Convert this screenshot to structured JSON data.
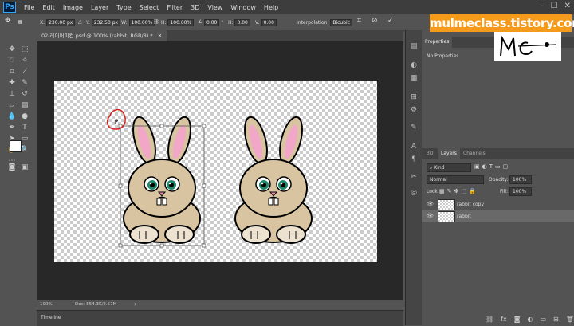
{
  "app": {
    "logo": "Ps"
  },
  "menu": [
    "File",
    "Edit",
    "Image",
    "Layer",
    "Type",
    "Select",
    "Filter",
    "3D",
    "View",
    "Window",
    "Help"
  ],
  "window_controls": [
    "–",
    "☐",
    "✕"
  ],
  "options": {
    "x_label": "X:",
    "x_value": "230.00 px",
    "y_label": "Y:",
    "y_value": "232.50 px",
    "w_label": "W:",
    "w_value": "100.00%",
    "h_label": "H:",
    "h_value": "100.00%",
    "angle_value": "0.00",
    "h2_label": "H:",
    "h2_value": "0.00",
    "v_label": "V:",
    "v_value": "0.00",
    "interp_label": "Interpolation:",
    "interp_value": "Bicubic"
  },
  "document": {
    "tab_title": "02-레이어피컨.psd @ 100% (rabbit, RGB/8) *",
    "tab_close": "✕"
  },
  "status": {
    "zoom": "100%",
    "doc_info": "Doc: 854.3K/2.57M"
  },
  "timeline": {
    "label": "Timeline"
  },
  "properties": {
    "tab": "Properties",
    "text": "No Properties"
  },
  "layers_panel": {
    "tabs": [
      "3D",
      "Layers",
      "Channels"
    ],
    "kind": "Kind",
    "blend_mode": "Normal",
    "opacity_label": "Opacity:",
    "opacity_value": "100%",
    "lock_label": "Lock:",
    "fill_label": "Fill:",
    "fill_value": "100%",
    "layers": [
      {
        "name": "rabbit copy",
        "selected": false
      },
      {
        "name": "rabbit",
        "selected": true
      }
    ]
  },
  "watermark": {
    "text": "mulmeclass.tistory.com",
    "signature": "Mc"
  },
  "colors": {
    "accent": "#f59a1b",
    "panel": "#535353",
    "dark": "#282828",
    "selection": "#696969"
  }
}
